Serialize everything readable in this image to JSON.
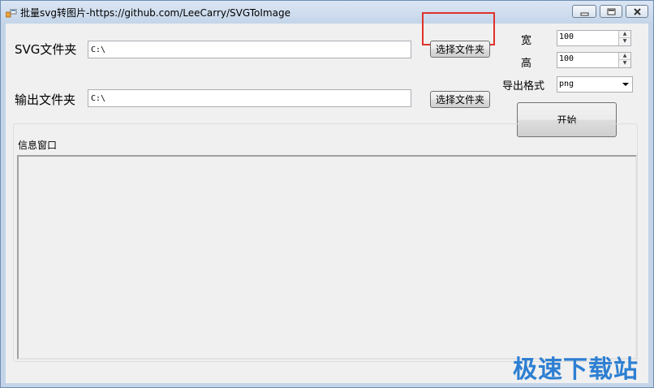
{
  "window": {
    "title": "批量svg转图片-https://github.com/LeeCarry/SVGToImage"
  },
  "form": {
    "svg_folder_label": "SVG文件夹",
    "svg_folder_value": "C:\\",
    "output_folder_label": "输出文件夹",
    "output_folder_value": "C:\\",
    "browse_svg_label": "选择文件夹",
    "browse_output_label": "选择文件夹",
    "width_label": "宽",
    "width_value": "100",
    "height_label": "高",
    "height_value": "100",
    "format_label": "导出格式",
    "format_value": "png",
    "start_label": "开始"
  },
  "log": {
    "group_title": "信息窗口"
  },
  "watermark": {
    "text": "极速下载站"
  },
  "colors": {
    "highlight": "#e0312b",
    "watermark": "#2d7fd2"
  }
}
